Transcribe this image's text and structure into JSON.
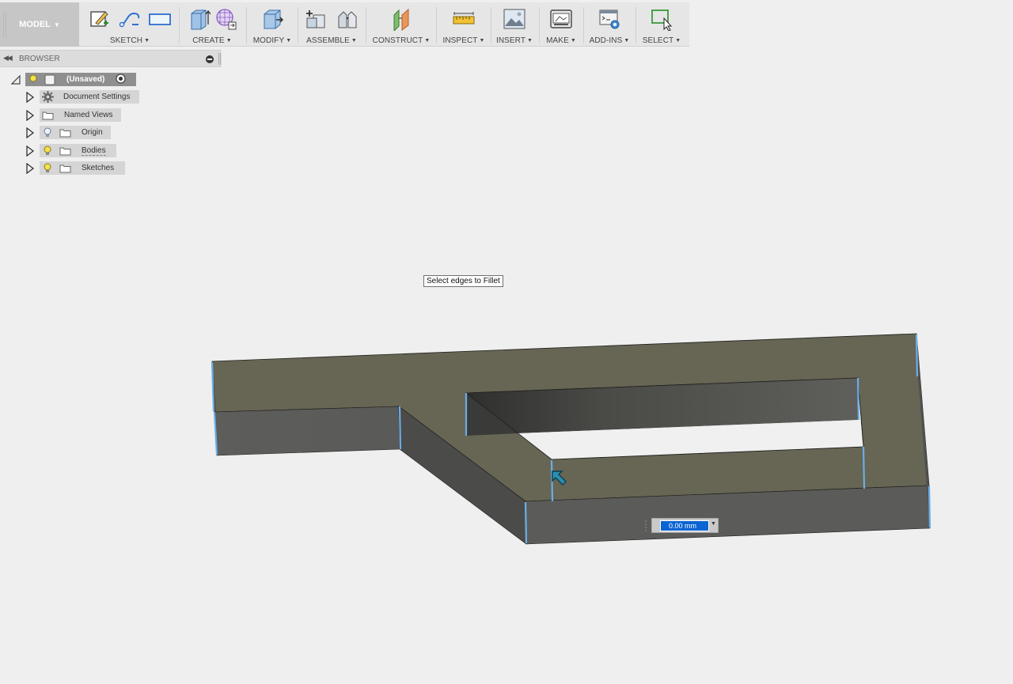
{
  "toolbar": {
    "workspace": "MODEL",
    "groups": [
      {
        "id": "sketch",
        "label": "SKETCH"
      },
      {
        "id": "create",
        "label": "CREATE"
      },
      {
        "id": "modify",
        "label": "MODIFY"
      },
      {
        "id": "assemble",
        "label": "ASSEMBLE"
      },
      {
        "id": "construct",
        "label": "CONSTRUCT"
      },
      {
        "id": "inspect",
        "label": "INSPECT"
      },
      {
        "id": "insert",
        "label": "INSERT"
      },
      {
        "id": "make",
        "label": "MAKE"
      },
      {
        "id": "addins",
        "label": "ADD-INS"
      },
      {
        "id": "select",
        "label": "SELECT"
      }
    ]
  },
  "browser": {
    "title": "BROWSER",
    "root": {
      "label": "(Unsaved)"
    },
    "items": [
      {
        "label": "Document Settings",
        "icon": "gear-icon"
      },
      {
        "label": "Named Views",
        "icon": "folder-icon"
      },
      {
        "label": "Origin",
        "icon": "folder-icon",
        "visibility": "hidden"
      },
      {
        "label": "Bodies",
        "icon": "folder-icon",
        "visibility": "visible"
      },
      {
        "label": "Sketches",
        "icon": "folder-icon",
        "visibility": "visible"
      }
    ]
  },
  "viewport": {
    "tooltip": "Select edges to Fillet",
    "fillet_radius": "0.00 mm"
  },
  "colors": {
    "top_face": "#676554",
    "side_face": "#5a5a58",
    "selected_edge": "#6aaee8",
    "input_highlight": "#0a64d2"
  }
}
